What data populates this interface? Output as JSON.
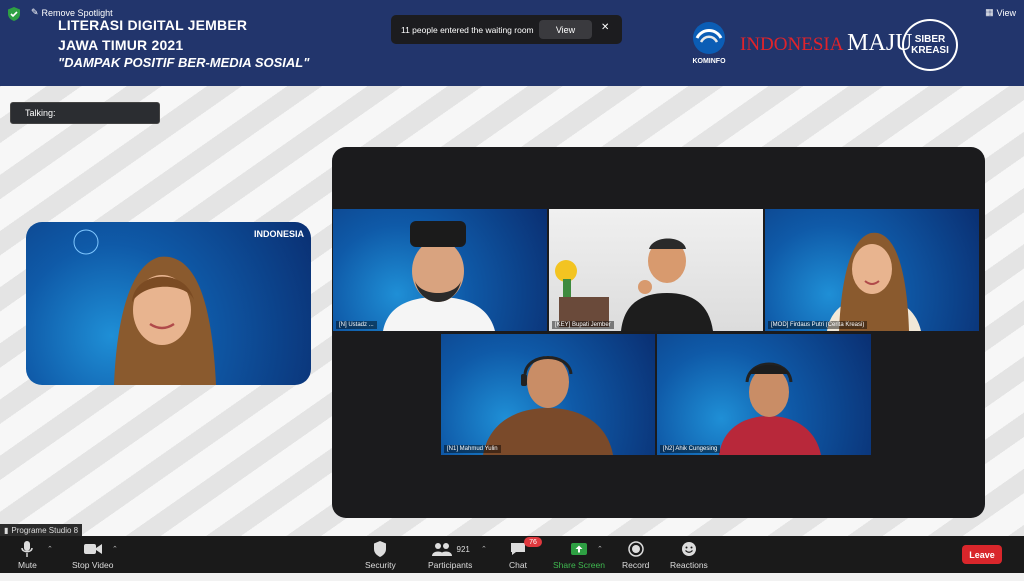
{
  "banner": {
    "remove_spotlight": "Remove Spotlight",
    "title_line1": "LITERASI DIGITAL JEMBER",
    "title_line2": "JAWA TIMUR 2021",
    "title_line3": "\"DAMPAK POSITIF BER-MEDIA SOSIAL\"",
    "view_label": "View",
    "logos": {
      "kominfo": "KOMINFO",
      "indonesia": "INDONESIA",
      "maju": "MAJU",
      "siber": "SIBER",
      "kreasi": "KREASI"
    }
  },
  "toast": {
    "message": "11 people entered the waiting room",
    "view_button": "View",
    "close": "✕"
  },
  "talking": {
    "label": "Talking:"
  },
  "speaker": {
    "indonesia_text": "INDONESIA"
  },
  "participants": [
    {
      "name": "[N] Ustadz ...",
      "bg": "video"
    },
    {
      "name": "[KEY] Bupati Jember",
      "bg": "white"
    },
    {
      "name": "[MOD] Firdaus Putri (Cerita Kreasi)",
      "bg": "video"
    },
    {
      "name": "[N1] Mahmud Yulin",
      "bg": "video"
    },
    {
      "name": "[N2] Ahik Cungesing",
      "bg": "video"
    }
  ],
  "studio_label": "Programe Studio 8",
  "toolbar": {
    "mute": "Mute",
    "stop_video": "Stop Video",
    "security": "Security",
    "participants": "Participants",
    "participants_count": "921",
    "chat": "Chat",
    "chat_badge": "76",
    "share_screen": "Share Screen",
    "record": "Record",
    "reactions": "Reactions",
    "leave": "Leave"
  },
  "colors": {
    "banner": "#22356c",
    "share_green": "#2ea043",
    "leave_red": "#d9262b"
  }
}
